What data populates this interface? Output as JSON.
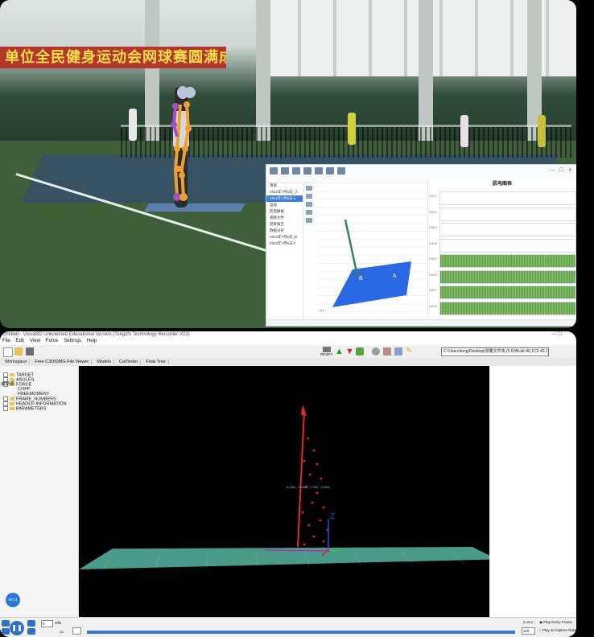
{
  "top": {
    "banner_text": "单位全民健身运动会网球赛圆满成功",
    "app": {
      "emg_title": "肌电图表",
      "window_controls": "— ☐ ✕",
      "tree": [
        "项目",
        "2022年7月5日_人",
        "2022年7月5日人",
        "运动",
        "肌电数据",
        "视频文件",
        "结果报告",
        "数据分析",
        "2022年7月5日_B",
        "2022年7月5日人"
      ],
      "selected_index": 2,
      "emg_rows": [
        {
          "label": "EMG1",
          "active": false
        },
        {
          "label": "EMG2",
          "active": false
        },
        {
          "label": "EMG3",
          "active": false
        },
        {
          "label": "EMG4",
          "active": false
        },
        {
          "label": "EMG5",
          "active": true
        },
        {
          "label": "EMG6",
          "active": true
        },
        {
          "label": "EMG7",
          "active": true
        },
        {
          "label": "EMG8",
          "active": true
        }
      ],
      "plate_labels": [
        "B",
        "A"
      ],
      "axis_label": "1:1"
    }
  },
  "bottom": {
    "title": "Untitled - Visual3D Unlicensed Educational Version (Tongzhi Technology Recorder V22)",
    "menus": [
      "File",
      "Edit",
      "View",
      "Force",
      "Settings",
      "Help"
    ],
    "reset_label": "RESET",
    "file_path": "C:\\Users\\tong\\Desktop\\测量文件夹 (0.60M-alt-46,1C2-46,1C2)",
    "tabs": [
      "Workspace",
      "Free C3D/DMG File Viewer",
      "Models",
      "CalTester",
      "Final Tree"
    ],
    "tree_items": [
      {
        "label": "TARGET",
        "icon": "box"
      },
      {
        "label": "ANGLES",
        "icon": "box"
      },
      {
        "label": "FORCE",
        "icon": "box"
      },
      {
        "label": "COFP",
        "icon": "none"
      },
      {
        "label": "FREEMOMENT",
        "icon": "none"
      },
      {
        "label": "FRAME_NUMBERS",
        "icon": "box"
      },
      {
        "label": "HEADER INFORMATION",
        "icon": "box"
      },
      {
        "label": "PARAMETERS",
        "icon": "box"
      }
    ],
    "tree_side_label": "启动项",
    "force_tag": "0.00N - 0.00N - 7.72N - 0.00N",
    "axis_z": "Z",
    "avatar_text": "00:14",
    "playback": {
      "frame_value": "0",
      "offset_label": "Offs",
      "step_label": "1x",
      "speed": "2.15 x",
      "frame_total": "129",
      "opt_every": "Play Every Frame",
      "opt_capture": "Play at Capture Rate"
    }
  }
}
